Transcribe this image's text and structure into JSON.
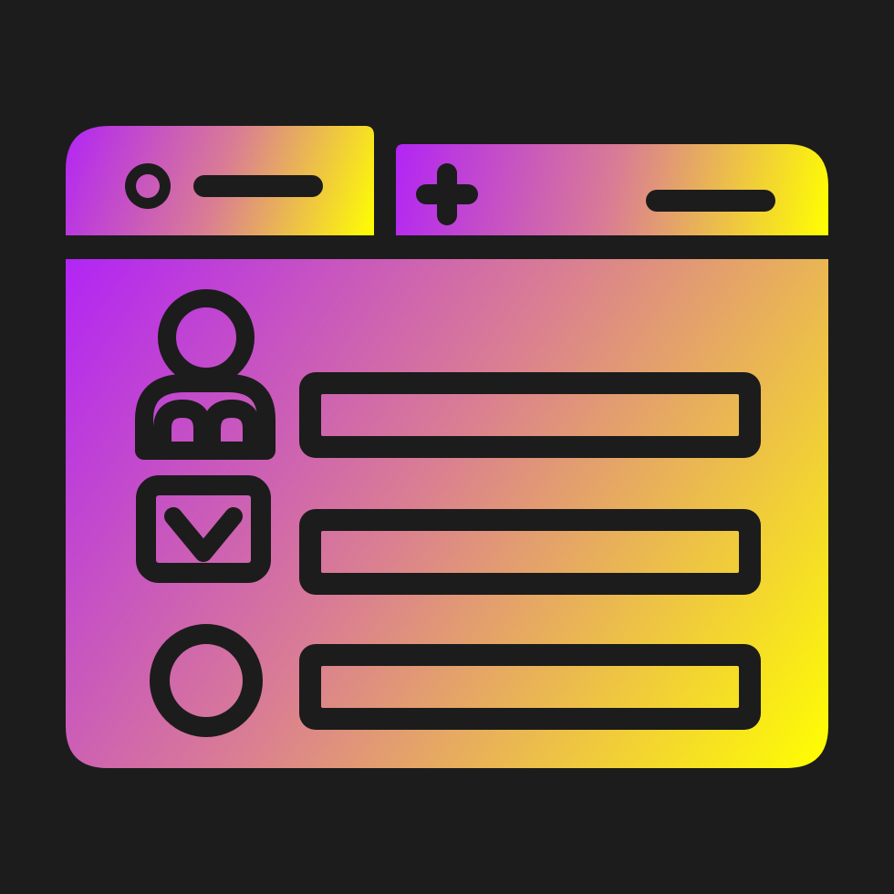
{
  "icon": {
    "name": "registration-form-browser",
    "background": "#1c1c1c",
    "ink": "#1c1c1c",
    "gradient": [
      "#b225f5",
      "#d97c95",
      "#ffff00"
    ]
  },
  "tabs": [
    {
      "name": "tab-active",
      "icons": [
        "radio-dot-icon",
        "title-line-icon"
      ]
    },
    {
      "name": "tab-new",
      "icons": [
        "plus-icon",
        "title-line-icon"
      ]
    }
  ],
  "form": {
    "rows": [
      {
        "icon": "user-icon",
        "field": "name-field"
      },
      {
        "icon": "mail-icon",
        "field": "email-field"
      },
      {
        "icon": "circle-icon",
        "field": "generic-field"
      }
    ]
  }
}
